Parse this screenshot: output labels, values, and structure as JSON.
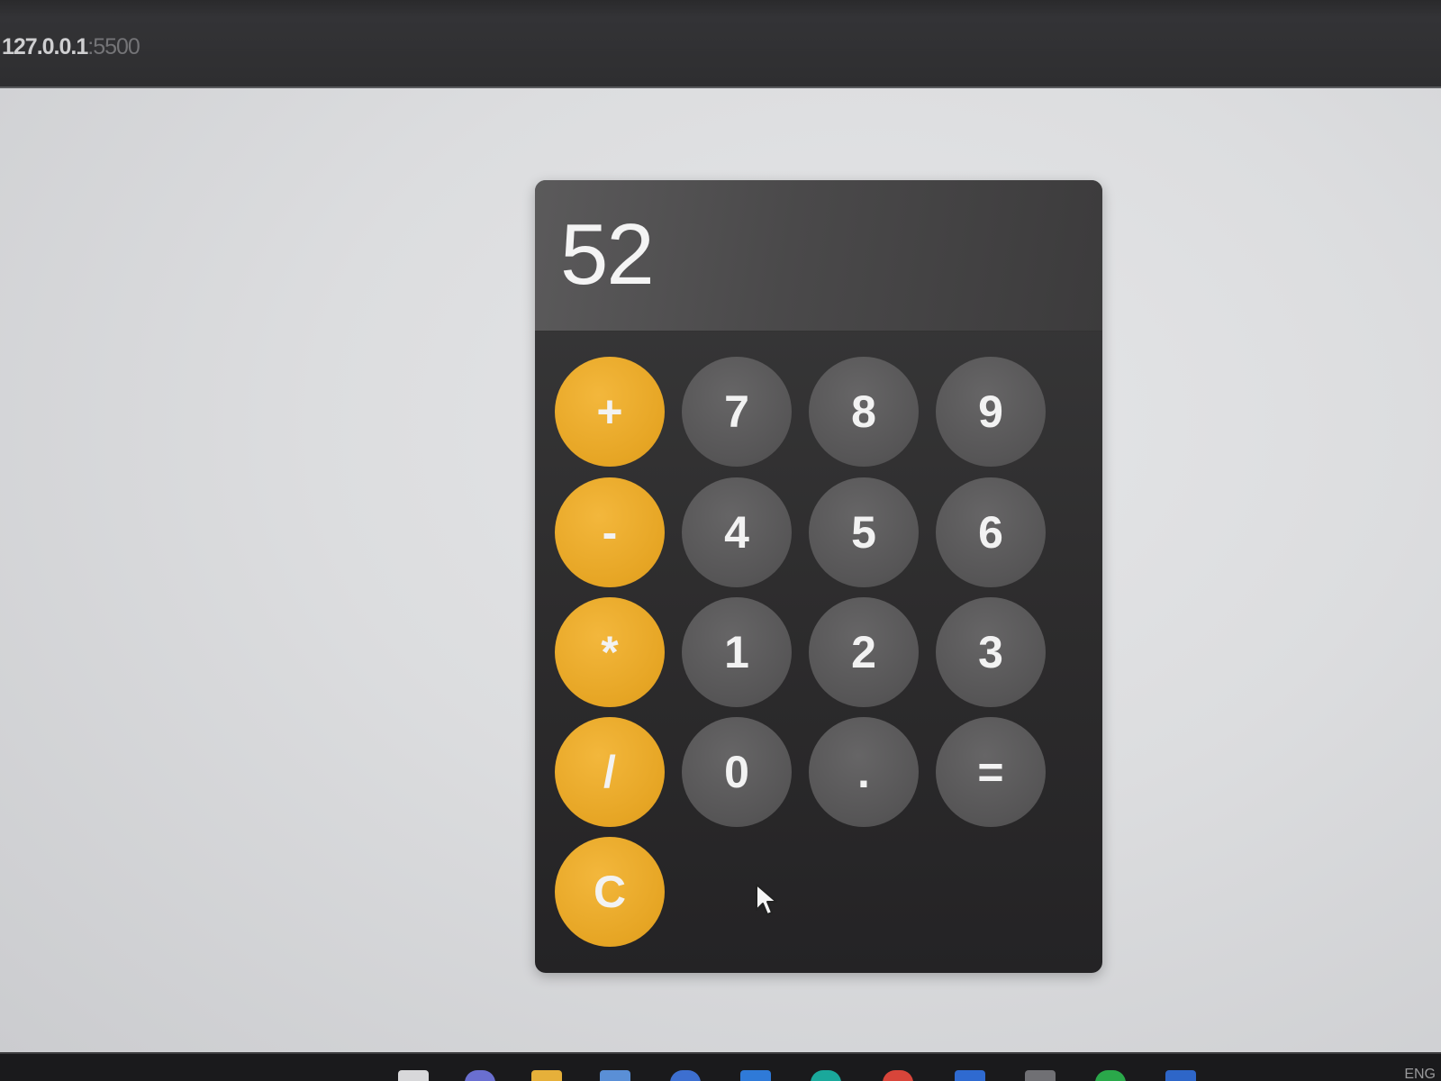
{
  "browser": {
    "url_host": "127.0.0.1",
    "url_port": ":5500"
  },
  "calculator": {
    "display_value": "52",
    "buttons": {
      "add": "+",
      "subtract": "-",
      "multiply": "*",
      "divide": "/",
      "clear": "C",
      "seven": "7",
      "eight": "8",
      "nine": "9",
      "four": "4",
      "five": "5",
      "six": "6",
      "one": "1",
      "two": "2",
      "three": "3",
      "zero": "0",
      "decimal": ".",
      "equals": "="
    }
  },
  "taskbar": {
    "language": "ENG"
  },
  "colors": {
    "operator": "#e6a524",
    "number": "#565556",
    "body": "#2d2c2d"
  }
}
